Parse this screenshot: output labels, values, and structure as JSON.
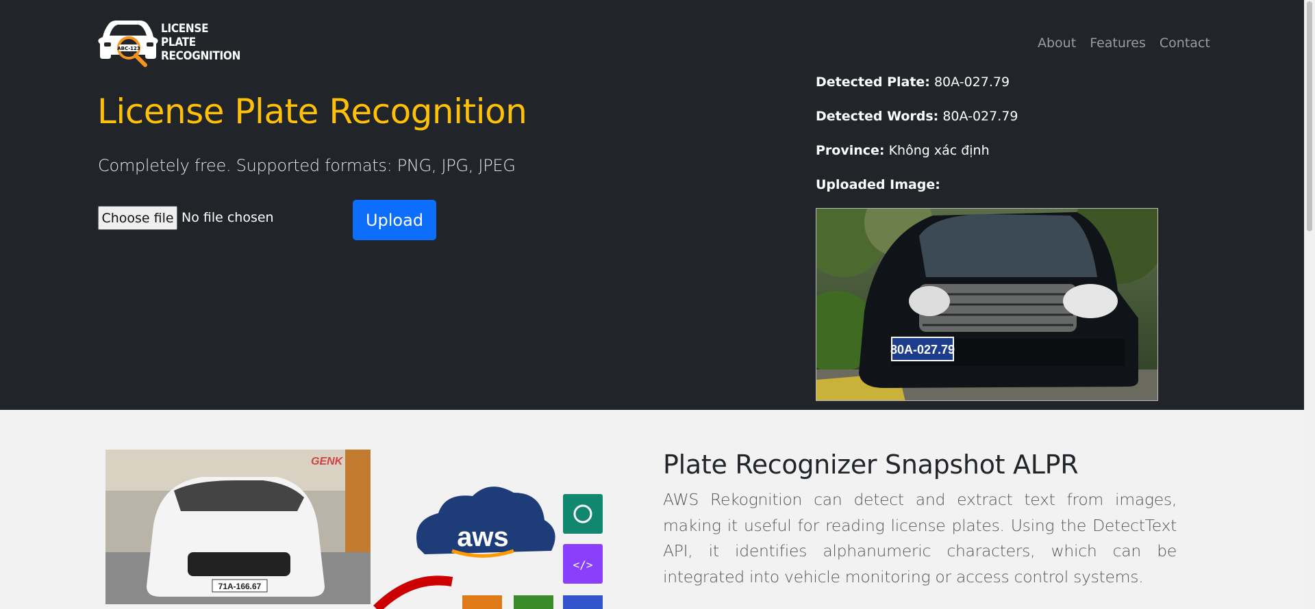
{
  "logo": {
    "lines": [
      "LICENSE",
      "PLATE",
      "RECOGNITION"
    ],
    "plate_text": "ABC-123"
  },
  "nav": {
    "items": [
      "About",
      "Features",
      "Contact"
    ]
  },
  "hero": {
    "title": "License Plate Recognition",
    "subtitle": "Completely free. Supported formats: PNG, JPG, JPEG",
    "file_button": "Choose file",
    "file_status": "No file chosen",
    "upload_button": "Upload"
  },
  "result": {
    "plate_label": "Detected Plate:",
    "plate_value": "80A-027.79",
    "words_label": "Detected Words:",
    "words_value": "80A-027.79",
    "province_label": "Province:",
    "province_value": "Không xác định",
    "image_label": "Uploaded Image:",
    "image_plate": "80A-027.79"
  },
  "feature": {
    "title": "Plate Recognizer Snapshot ALPR",
    "text": "AWS Rekognition can detect and extract text from images, making it useful for reading license plates. Using the DetectText API, it identifies alphanumeric characters, which can be integrated into vehicle monitoring or access control systems.",
    "image_plate": "71A-166.67",
    "image_watermark": "GENK",
    "aws_label": "aws"
  },
  "colors": {
    "hero_bg": "#212529",
    "accent": "#ffc107",
    "primary": "#0d6efd",
    "page_bg": "#f2f2f2"
  }
}
